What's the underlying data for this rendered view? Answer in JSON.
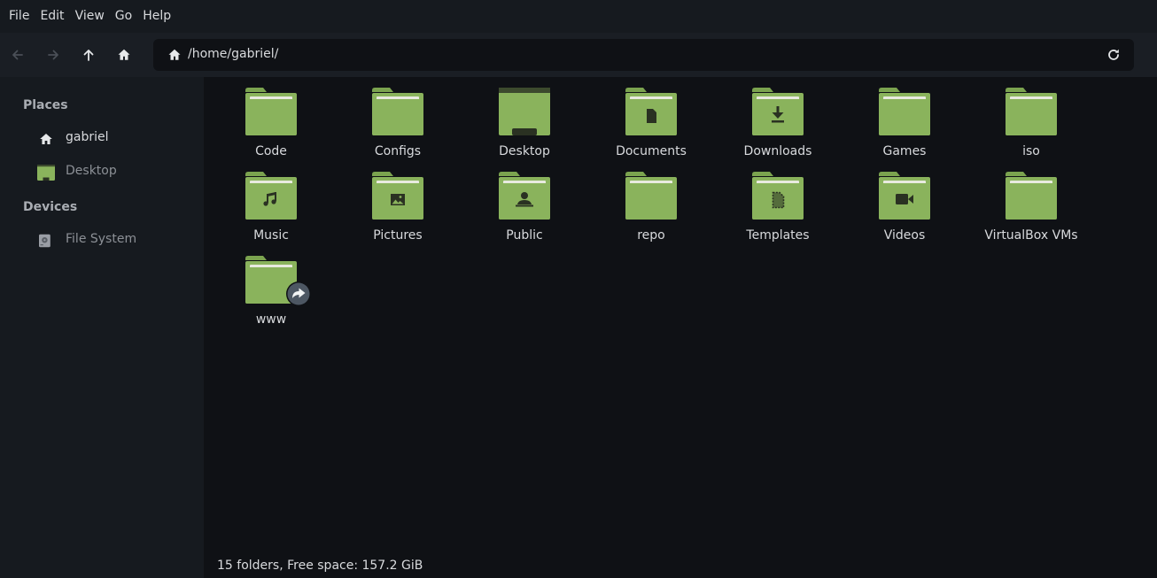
{
  "menubar": {
    "items": [
      "File",
      "Edit",
      "View",
      "Go",
      "Help"
    ]
  },
  "toolbar": {
    "buttons": [
      {
        "name": "back",
        "icon": "arrow-left-icon",
        "enabled": false
      },
      {
        "name": "forward",
        "icon": "arrow-right-icon",
        "enabled": false
      },
      {
        "name": "up",
        "icon": "arrow-up-icon",
        "enabled": true
      },
      {
        "name": "home",
        "icon": "home-icon",
        "enabled": true
      }
    ],
    "location": {
      "path": "/home/gabriel/",
      "icon": "home-icon",
      "refresh_icon": "refresh-icon"
    }
  },
  "sidebar": {
    "places_heading": "Places",
    "places": [
      {
        "label": "gabriel",
        "icon": "home-icon"
      },
      {
        "label": "Desktop",
        "icon": "desktop-folder-icon"
      }
    ],
    "devices_heading": "Devices",
    "devices": [
      {
        "label": "File System",
        "icon": "drive-icon"
      }
    ]
  },
  "folders": [
    {
      "label": "Code",
      "icon": "folder-icon"
    },
    {
      "label": "Configs",
      "icon": "folder-icon"
    },
    {
      "label": "Desktop",
      "icon": "desktop-folder-icon"
    },
    {
      "label": "Documents",
      "icon": "folder-documents-icon"
    },
    {
      "label": "Downloads",
      "icon": "folder-downloads-icon"
    },
    {
      "label": "Games",
      "icon": "folder-icon"
    },
    {
      "label": "iso",
      "icon": "folder-icon"
    },
    {
      "label": "Music",
      "icon": "folder-music-icon"
    },
    {
      "label": "Pictures",
      "icon": "folder-pictures-icon"
    },
    {
      "label": "Public",
      "icon": "folder-public-icon"
    },
    {
      "label": "repo",
      "icon": "folder-icon"
    },
    {
      "label": "Templates",
      "icon": "folder-templates-icon"
    },
    {
      "label": "Videos",
      "icon": "folder-videos-icon"
    },
    {
      "label": "VirtualBox VMs",
      "icon": "folder-icon"
    },
    {
      "label": "www",
      "icon": "folder-symlink-icon"
    }
  ],
  "status": {
    "text": "15 folders, Free space: 157.2 GiB"
  },
  "colors": {
    "folder_green": "#8ab35c",
    "folder_tab": "#7ba34f",
    "folder_paper": "#e8eadf",
    "glyph": "#2a3122",
    "background": "#0f1115",
    "sidebar": "#161a1f"
  }
}
